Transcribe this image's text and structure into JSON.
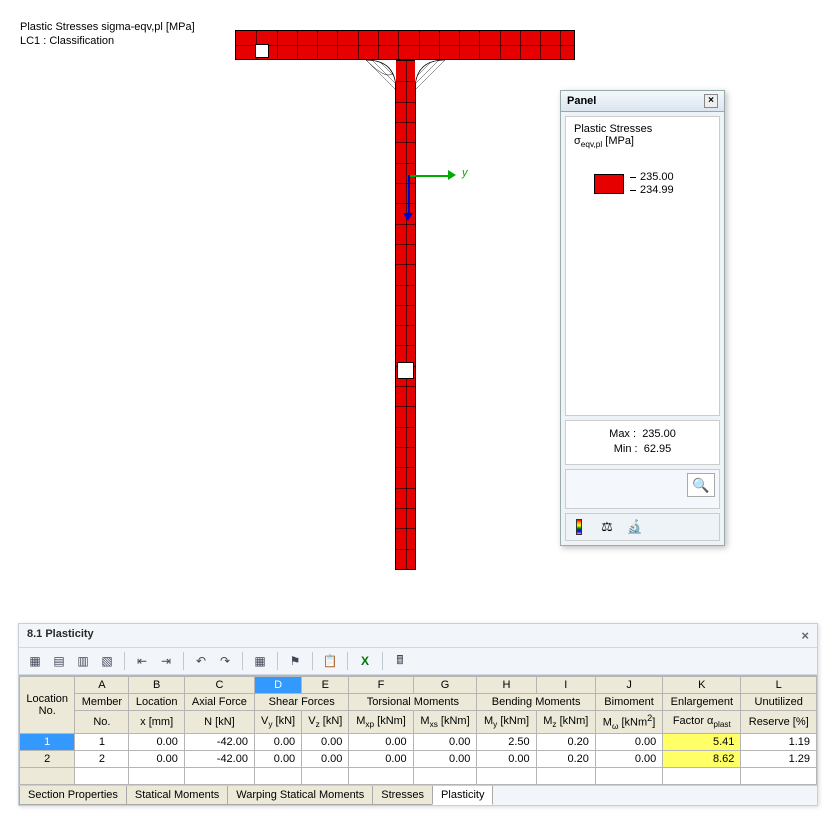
{
  "viewport": {
    "line1": "Plastic Stresses sigma-eqv,pl [MPa]",
    "line2": "LC1 : Classification"
  },
  "axes": {
    "y_label": "y"
  },
  "panel": {
    "title": "Panel",
    "legend_title1": "Plastic Stresses",
    "legend_title2": "σeqv,pl [MPa]",
    "legend_color": "#e60000",
    "legend_high": "235.00",
    "legend_low": "234.99",
    "max_label": "Max  :",
    "max_value": "235.00",
    "min_label": "Min   :",
    "min_value": "62.95"
  },
  "results": {
    "title": "8.1 Plasticity",
    "col_letters": [
      "A",
      "B",
      "C",
      "D",
      "E",
      "F",
      "G",
      "H",
      "I",
      "J",
      "K",
      "L"
    ],
    "header_row1": {
      "loc": "Location",
      "member": "Member",
      "location": "Location",
      "axial": "Axial Force",
      "shear": "Shear Forces",
      "torsion": "Torsional Moments",
      "bending": "Bending Moments",
      "bimoment": "Bimoment",
      "enlarge": "Enlargement",
      "unutil": "Unutilized"
    },
    "header_row2": {
      "loc": "No.",
      "member": "No.",
      "location": "x [mm]",
      "axial": "N [kN]",
      "vy": "Vy [kN]",
      "vz": "Vz [kN]",
      "mxp": "Mxp [kNm]",
      "mxs": "Mxs [kNm]",
      "my": "My [kNm]",
      "mz": "Mz [kNm]",
      "mw": "Mω [kNm²]",
      "factor": "Factor αplast",
      "reserve": "Reserve [%]"
    },
    "rows": [
      {
        "no": "1",
        "member": "1",
        "x": "0.00",
        "N": "-42.00",
        "Vy": "0.00",
        "Vz": "0.00",
        "Mxp": "0.00",
        "Mxs": "0.00",
        "My": "2.50",
        "Mz": "0.20",
        "Mw": "0.00",
        "factor": "5.41",
        "reserve": "1.19"
      },
      {
        "no": "2",
        "member": "2",
        "x": "0.00",
        "N": "-42.00",
        "Vy": "0.00",
        "Vz": "0.00",
        "Mxp": "0.00",
        "Mxs": "0.00",
        "My": "0.00",
        "Mz": "0.20",
        "Mw": "0.00",
        "factor": "8.62",
        "reserve": "1.29"
      }
    ],
    "tabs": [
      "Section Properties",
      "Statical Moments",
      "Warping Statical Moments",
      "Stresses",
      "Plasticity"
    ],
    "active_tab": 4
  }
}
